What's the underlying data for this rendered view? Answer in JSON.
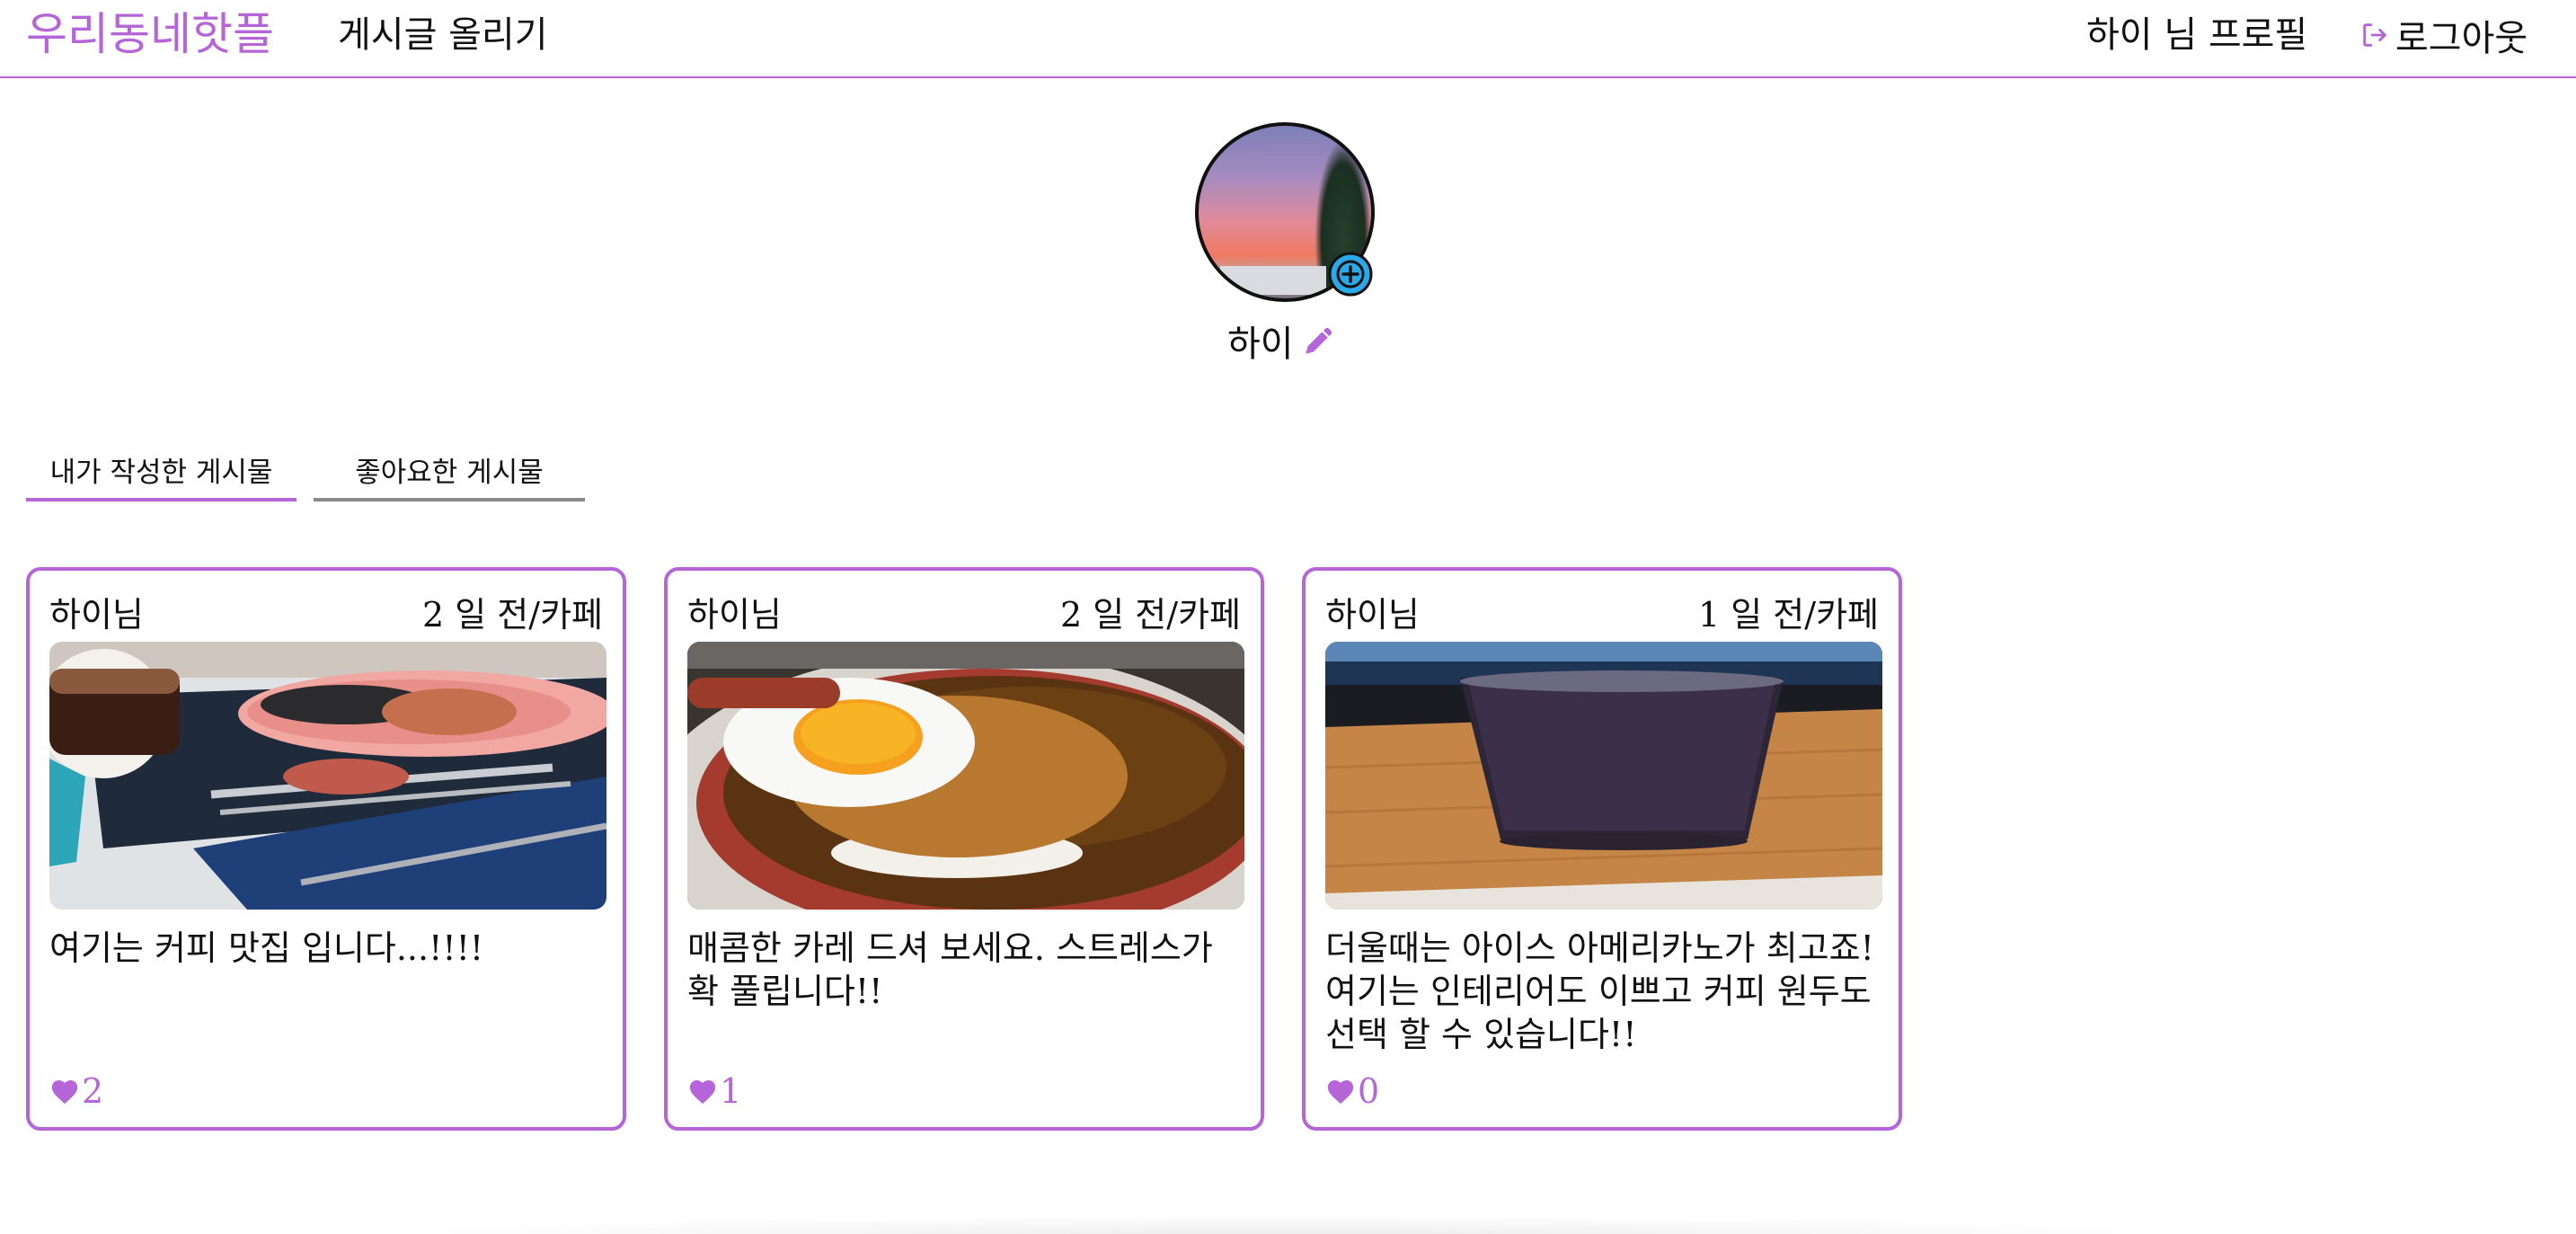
{
  "nav": {
    "brand": "우리동네핫플",
    "post_link": "게시글 올리기",
    "profile_link": "하이 님 프로필",
    "logout_label": "로그아웃",
    "logout_icon": "logout-icon"
  },
  "profile": {
    "nickname": "하이",
    "edit_icon": "pencil-icon",
    "add_photo_icon": "plus-circle-icon"
  },
  "tabs": [
    {
      "label": "내가 작성한 게시물",
      "active": true
    },
    {
      "label": "좋아요한 게시물",
      "active": false
    }
  ],
  "posts": [
    {
      "author": "하이님",
      "meta": "2 일 전/카페",
      "content": "여기는 커피 맛집 입니다...!!!!",
      "likes": "2"
    },
    {
      "author": "하이님",
      "meta": "2 일 전/카페",
      "content": "매콤한 카레 드셔 보세요. 스트레스가 확 풀립니다!!",
      "likes": "1"
    },
    {
      "author": "하이님",
      "meta": "1 일 전/카페",
      "content": "더울때는 아이스 아메리카노가 최고죠! 여기는 인테리어도 이쁘고 커피 원두도 선택 할 수 있습니다!!",
      "likes": "0"
    }
  ],
  "colors": {
    "accent": "#b565d8",
    "text": "#111111",
    "tab_inactive": "#8a8a8a",
    "plus_badge": "#2aa8e8"
  }
}
